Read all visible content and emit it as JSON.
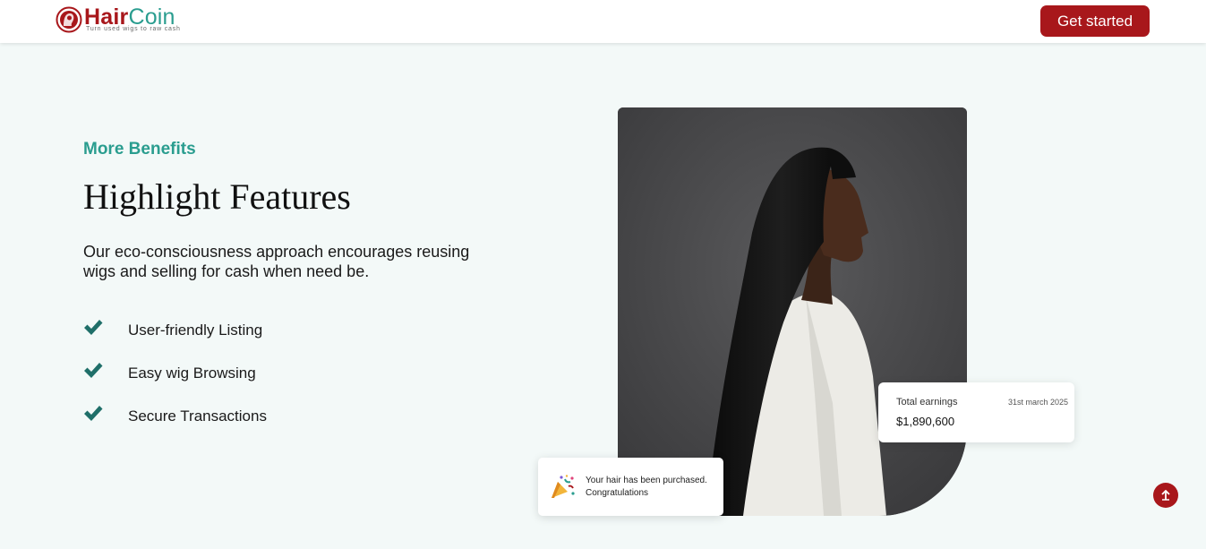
{
  "brand": {
    "name_part1": "Hair",
    "name_part2": "Coin",
    "tagline": "Turn used wigs to raw cash",
    "primary_color": "#a8171b",
    "accent_color": "#2a9d8f"
  },
  "nav": {
    "cta_label": "Get started"
  },
  "hero": {
    "eyebrow": "More Benefits",
    "title": "Highlight Features",
    "description": "Our eco-consciousness approach encourages reusing wigs and selling for cash when need be.",
    "features": [
      {
        "label": "User-friendly Listing",
        "icon": "check-icon"
      },
      {
        "label": "Easy wig Browsing",
        "icon": "check-icon"
      },
      {
        "label": "Secure Transactions",
        "icon": "check-icon"
      }
    ]
  },
  "earnings_card": {
    "label": "Total earnings",
    "date": "31st march 2025",
    "value": "$1,890,600"
  },
  "notification": {
    "icon": "party-popper-icon",
    "text": "Your hair has been purchased. Congratulations"
  },
  "scroll_top": {
    "icon": "arrow-up-icon"
  }
}
